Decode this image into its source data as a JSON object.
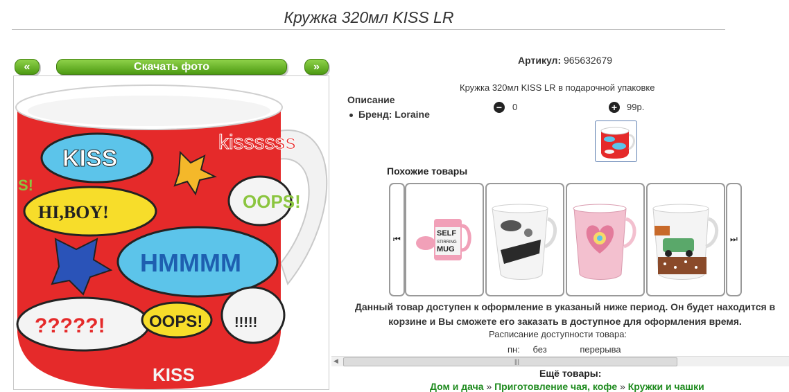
{
  "page": {
    "title": "Кружка 320мл KISS LR"
  },
  "gallery": {
    "prev_label": "«",
    "download_label": "Скачать фото",
    "next_label": "»",
    "photo_texts": [
      "KISS",
      "kissssss",
      "HI,BOY!",
      "OOPS!",
      "HMMMM",
      "?????!",
      "OOPS!",
      "!!!!!",
      "KISS",
      "S!"
    ]
  },
  "product": {
    "article_label": "Артикул:",
    "article_value": "965632679",
    "description_text": "Кружка 320мл KISS LR в подарочной упаковке",
    "description_heading": "Описание",
    "brand_label": "Бренд: Loraine",
    "quantity": "0",
    "price": "99р."
  },
  "similar": {
    "heading": "Похожие товары",
    "items": [
      {
        "caption": "SELF STIRRING MUG"
      },
      {
        "caption": ""
      },
      {
        "caption": ""
      },
      {
        "caption": ""
      }
    ]
  },
  "availability": {
    "notice": "Данный товар доступен к оформление в указаный ниже период. Он будет находится в корзине и Вы сможете его заказать в доступное для оформления время.",
    "schedule_label": "Расписание доступности товара:",
    "schedule_day": "пн:",
    "schedule_word1": "без",
    "schedule_word2": "перерыва"
  },
  "more": {
    "heading": "Ещё товары:",
    "crumbs": [
      "Дом и дача",
      "Приготовление чая, кофе",
      "Кружки и чашки"
    ],
    "separator": "»"
  },
  "colors": {
    "accent_green": "#4d9a12",
    "link_green": "#1f8b1f",
    "thumb_border": "#5c7eb0"
  }
}
